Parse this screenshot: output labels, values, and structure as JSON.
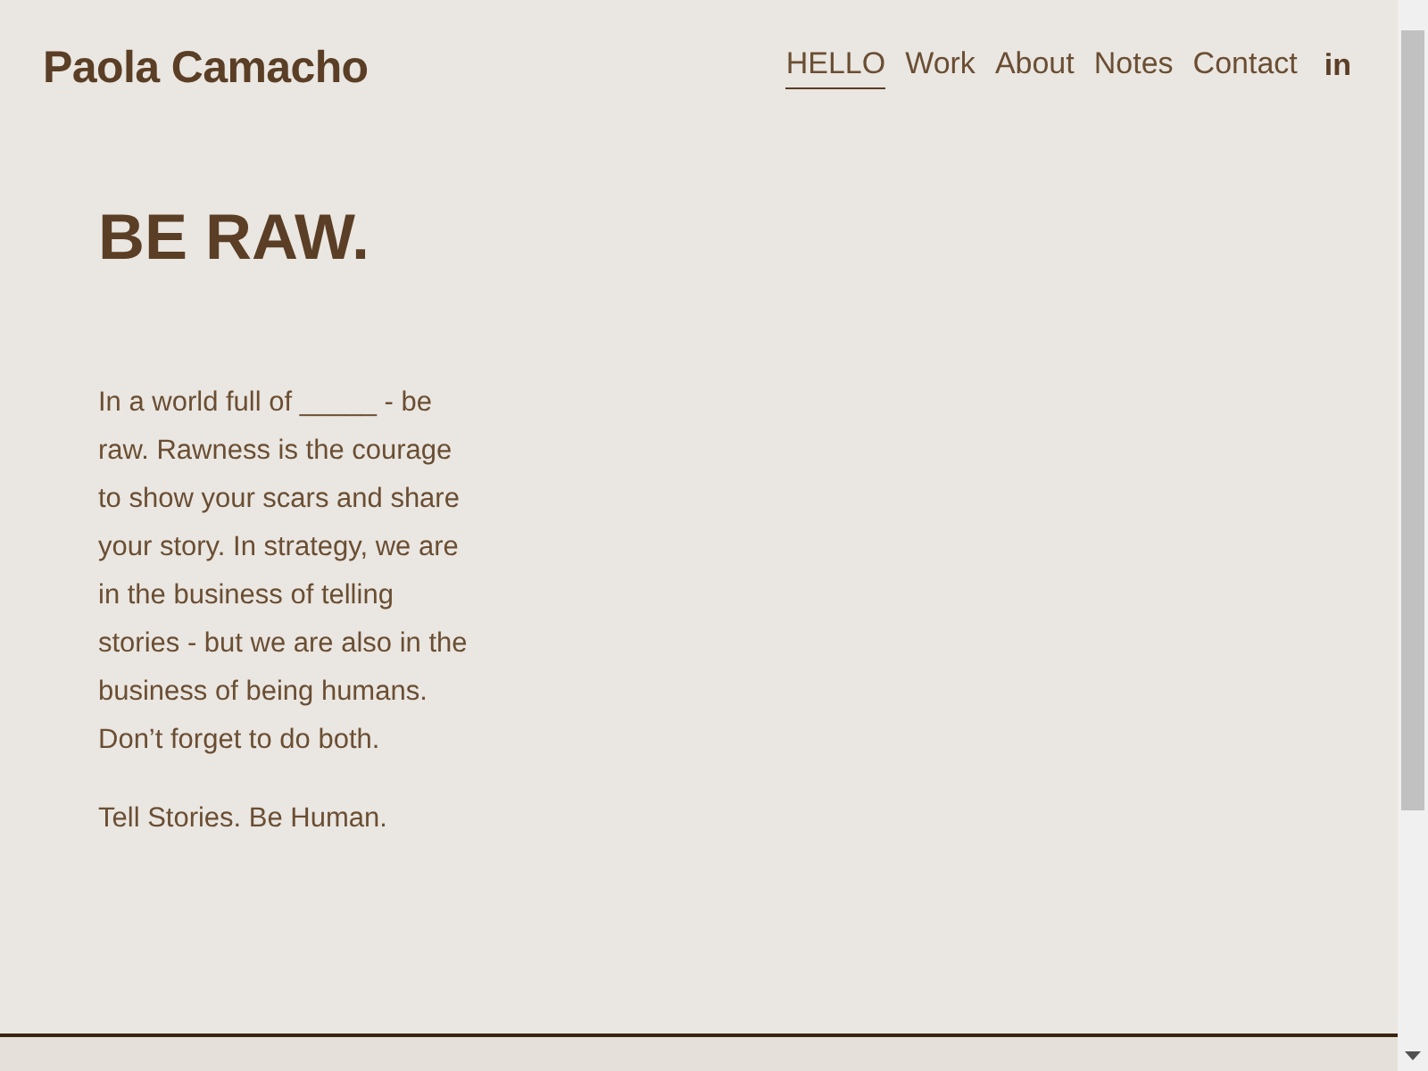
{
  "header": {
    "site_title": "Paola Camacho",
    "nav": [
      {
        "label": "HELLO",
        "selected": true
      },
      {
        "label": "Work",
        "selected": false
      },
      {
        "label": "About",
        "selected": false
      },
      {
        "label": "Notes",
        "selected": false
      },
      {
        "label": "Contact",
        "selected": false
      }
    ],
    "social_link": "in"
  },
  "main": {
    "heading": "BE RAW.",
    "paragraphs": [
      "In a world full of _____ - be raw. Rawness is the courage to show your scars and share your story. In strategy, we are in the business of telling stories - but we are also in the business of being humans. Don’t forget to do both.",
      "Tell Stories. Be Human."
    ]
  }
}
